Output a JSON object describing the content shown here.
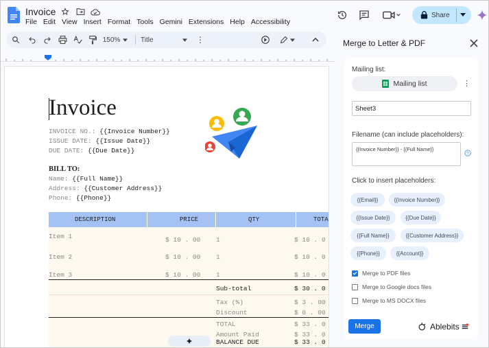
{
  "app": {
    "doc_title": "Invoice",
    "menu": [
      "File",
      "Edit",
      "View",
      "Insert",
      "Format",
      "Tools",
      "Gemini",
      "Extensions",
      "Help",
      "Accessibility"
    ],
    "share_label": "Share"
  },
  "toolbar": {
    "zoom": "150%",
    "style": "Title"
  },
  "document": {
    "heading": "Invoice",
    "meta": [
      {
        "label": "INVOICE NO.:",
        "value": "{{Invoice Number}}"
      },
      {
        "label": "ISSUE DATE:",
        "value": "{{Issue Date}}"
      },
      {
        "label": "DUE DATE:",
        "value": "{{Due Date}}"
      }
    ],
    "bill_to": "BILL TO:",
    "bill_fields": [
      {
        "label": "Name:",
        "value": "{{Full Name}}"
      },
      {
        "label": "Address:",
        "value": "{{Customer Address}}"
      },
      {
        "label": "Phone:",
        "value": "{{Phone}}"
      }
    ],
    "columns": [
      "DESCRIPTION",
      "PRICE",
      "QTY",
      "TOTA"
    ],
    "items": [
      {
        "desc": "Item 1",
        "price": "$ 10 . 00",
        "qty": "1",
        "total": "$ 10 . 0"
      },
      {
        "desc": "Item 2",
        "price": "$ 10 . 00",
        "qty": "1",
        "total": "$ 10 . 0"
      },
      {
        "desc": "Item 3",
        "price": "$ 10 . 00",
        "qty": "1",
        "total": "$ 10 . 0"
      }
    ],
    "subtotal": {
      "label": "Sub-total",
      "value": "$ 30 . 0"
    },
    "tax": {
      "label": "Tax (%)",
      "value": "$ 3 . 00"
    },
    "discount": {
      "label": "Discount",
      "value": "$ 0 . 00"
    },
    "total": {
      "label": "TOTAL",
      "value": "$ 33 . 0"
    },
    "amount_paid": {
      "label": "Amount Paid",
      "value": "$ 33 . 0"
    },
    "balance_due": {
      "label": "BALANCE DUE",
      "value": "$ 33 . 0"
    }
  },
  "sidebar": {
    "title": "Merge to Letter & PDF",
    "mailing_list_label": "Mailing list:",
    "mailing_list_button": "Mailing list",
    "sheet_value": "Sheet3",
    "filename_label": "Filename (can include placeholders):",
    "filename_value": "{{Invoice Number}} - {{Full Name}}",
    "placeholders_label": "Click to insert placeholders:",
    "placeholders": [
      "{{Email}}",
      "{{Invoice Number}}",
      "{{Issue Date}}",
      "{{Due Date}}",
      "{{Full Name}}",
      "{{Customer Address}}",
      "{{Phone}}",
      "{{Account}}"
    ],
    "options": [
      {
        "label": "Merge to PDF files",
        "checked": true
      },
      {
        "label": "Merge to Google docs files",
        "checked": false
      },
      {
        "label": "Merge to MS DOCX files",
        "checked": false
      }
    ],
    "merge_button": "Merge",
    "brand": "Ablebits"
  },
  "colors": {
    "accent": "#1a73e8",
    "share_bg": "#c2e7ff",
    "table_header": "#a4c2f4",
    "table_body": "#fdf9ef"
  }
}
